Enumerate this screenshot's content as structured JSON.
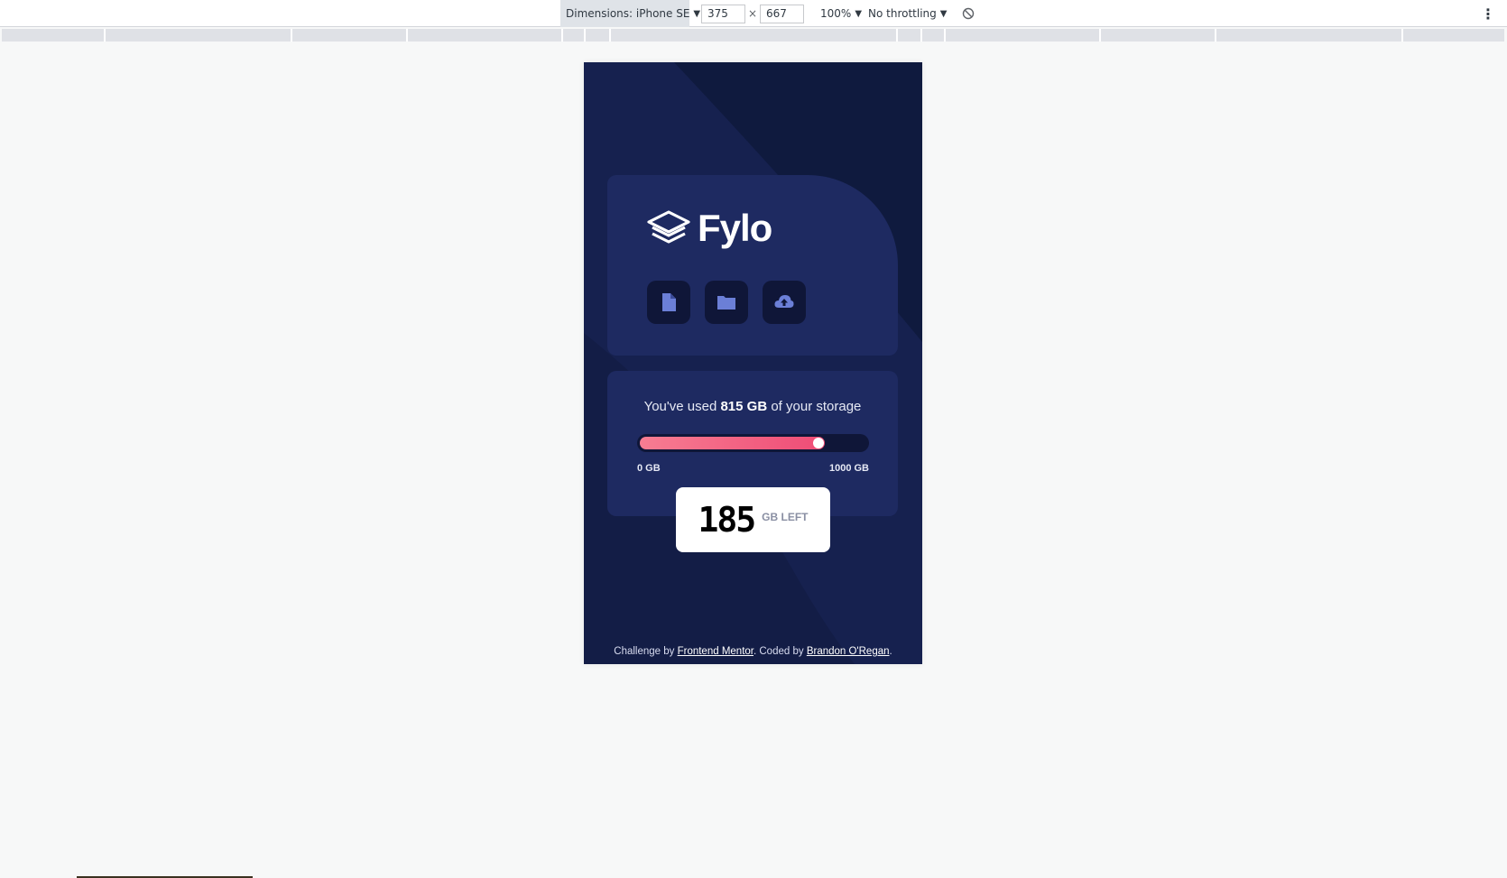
{
  "toolbar": {
    "device_label": "Dimensions: iPhone SE",
    "width_value": "375",
    "height_value": "667",
    "times_symbol": "×",
    "zoom_label": "100%",
    "throttle_label": "No throttling",
    "caret": "▼",
    "menu_glyph": "⋮"
  },
  "app": {
    "logo_text": "Fylo",
    "icons": [
      "document-icon",
      "folder-icon",
      "upload-icon"
    ],
    "usage_prefix": "You've used ",
    "usage_amount": "815 GB",
    "usage_suffix": " of your storage",
    "usage_fraction": 0.815,
    "bar_min_label": "0 GB",
    "bar_max_label": "1000 GB",
    "left_value": "185",
    "left_unit": "GB LEFT"
  },
  "footer": {
    "prefix": "Challenge by ",
    "challenge_link": "Frontend Mentor",
    "middle": ". Coded by ",
    "author_link": "Brandon O'Regan",
    "suffix": "."
  },
  "colors": {
    "page_bg": "#0f1a3e",
    "card_bg": "#1e2a61",
    "icon_bg": "#0f1638",
    "icon_fg": "#6b7fd7",
    "bar_gradient_start": "#f77d92",
    "bar_gradient_end": "#ef4c76"
  }
}
